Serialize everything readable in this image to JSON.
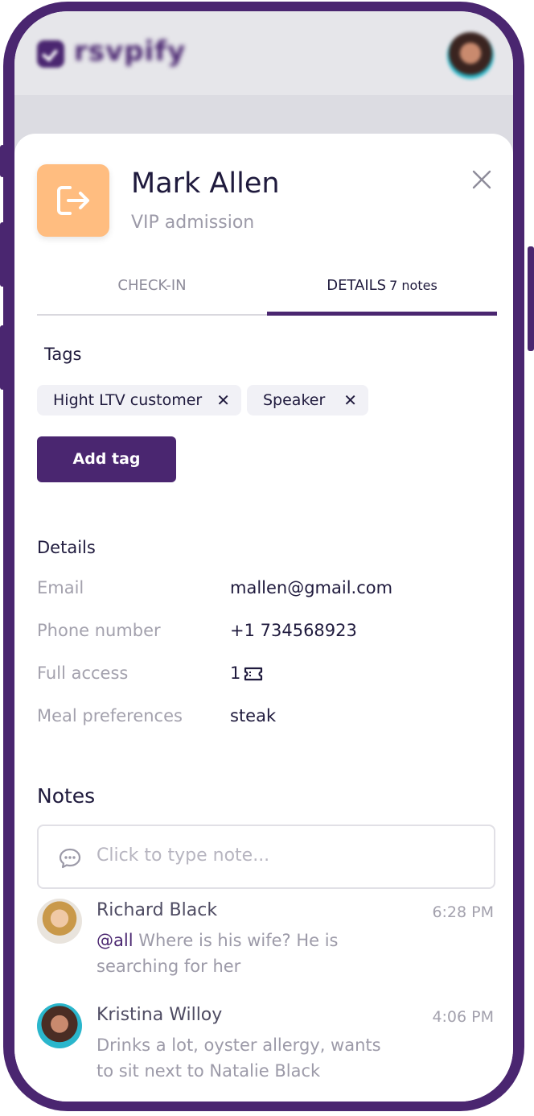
{
  "app": {
    "name": "rsvpify"
  },
  "guest": {
    "name": "Mark Allen",
    "admission": "VIP admission"
  },
  "tabs": {
    "checkin": "CHECK-IN",
    "details": "DETAILS",
    "details_count": "7 notes"
  },
  "tags": {
    "heading": "Tags",
    "items": [
      "Hight LTV customer",
      "Speaker"
    ],
    "add_label": "Add tag"
  },
  "details": {
    "heading": "Details",
    "rows": [
      {
        "label": "Email",
        "value": "mallen@gmail.com"
      },
      {
        "label": "Phone number",
        "value": "+1 734568923"
      },
      {
        "label": "Full access",
        "value": "1"
      },
      {
        "label": "Meal preferences",
        "value": "steak"
      }
    ]
  },
  "notes": {
    "heading": "Notes",
    "placeholder": "Click to type note...",
    "items": [
      {
        "author": "Richard Black",
        "time": "6:28 PM",
        "mention": "@all",
        "text": " Where is his wife? He is searching for her"
      },
      {
        "author": "Kristina Willoy",
        "time": "4:06 PM",
        "text": "Drinks a lot, oyster allergy, wants to sit next to Natalie Black"
      }
    ]
  },
  "colors": {
    "brand": "#4a2670",
    "header_icon_bg": "#ffbd80",
    "chip_bg": "#f1f1f6"
  },
  "icons": [
    "exit-icon",
    "close-icon",
    "ticket-icon",
    "chat-bubble-icon"
  ]
}
